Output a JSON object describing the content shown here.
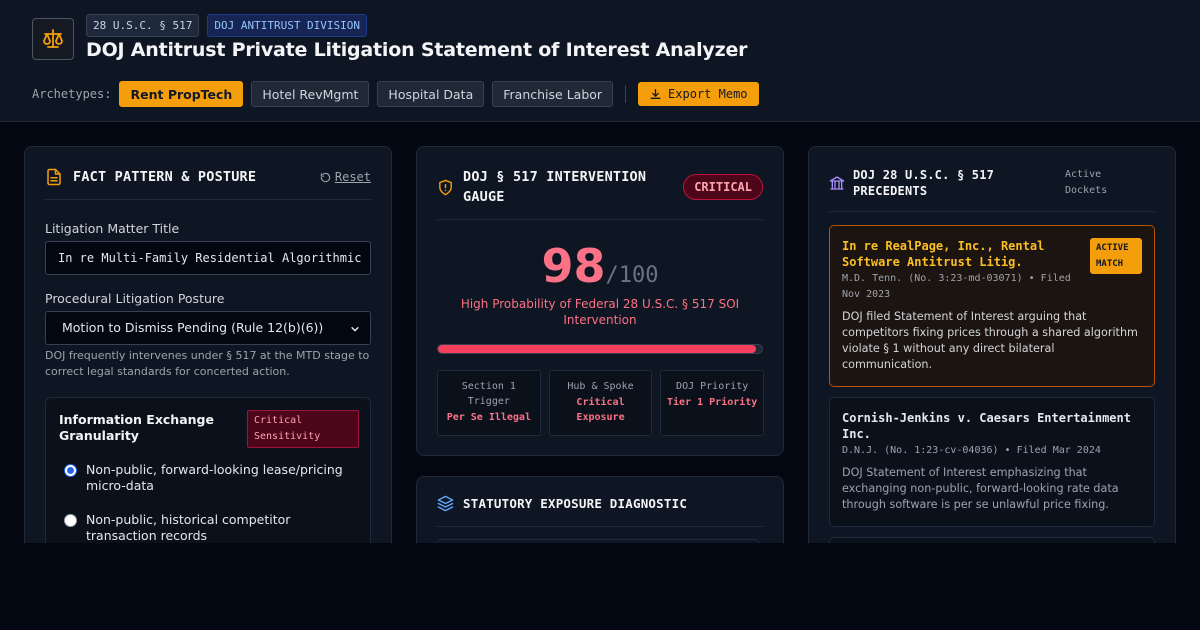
{
  "header": {
    "tag_statute": "28 U.S.C. § 517",
    "tag_division": "DOJ ANTITRUST DIVISION",
    "title": "DOJ Antitrust Private Litigation Statement of Interest Analyzer",
    "archetypes_label": "Archetypes:",
    "archetypes": [
      "Rent PropTech",
      "Hotel RevMgmt",
      "Hospital Data",
      "Franchise Labor"
    ],
    "active_archetype": "Rent PropTech",
    "export_label": "Export Memo",
    "logo_icon": "scales-icon"
  },
  "fact_pattern": {
    "title": "FACT PATTERN & POSTURE",
    "reset_label": "Reset",
    "matter_label": "Litigation Matter Title",
    "matter_value": "In re Multi-Family Residential Algorithmic",
    "posture_label": "Procedural Litigation Posture",
    "posture_value": "Motion to Dismiss Pending (Rule 12(b)(6))",
    "posture_help": "DOJ frequently intervenes under § 517 at the MTD stage to correct legal standards for concerted action.",
    "granularity": {
      "title": "Information Exchange Granularity",
      "badge": "Critical Sensitivity",
      "options": [
        {
          "label": "Non-public, forward-looking lease/pricing micro-data",
          "selected": true
        },
        {
          "label": "Non-public, historical competitor transaction records",
          "selected": false
        }
      ]
    }
  },
  "gauge": {
    "title": "DOJ § 517 INTERVENTION GAUGE",
    "severity": "CRITICAL",
    "score": "98",
    "score_max": "/100",
    "score_fraction": 0.98,
    "probability_text": "High Probability of Federal 28 U.S.C. § 517 SOI Intervention",
    "stats": [
      {
        "label": "Section 1 Trigger",
        "value": "Per Se Illegal"
      },
      {
        "label": "Hub & Spoke",
        "value": "Critical Exposure"
      },
      {
        "label": "DOJ Priority",
        "value": "Tier 1 Priority"
      }
    ]
  },
  "diagnostic": {
    "title": "STATUTORY EXPOSURE DIAGNOSTIC"
  },
  "precedents": {
    "title": "DOJ 28 U.S.C. § 517 PRECEDENTS",
    "status": "Active Dockets",
    "cases": [
      {
        "name": "In re RealPage, Inc., Rental Software Antitrust Litig.",
        "meta": "M.D. Tenn. (No. 3:23-md-03071) • Filed Nov 2023",
        "description": "DOJ filed Statement of Interest arguing that competitors fixing prices through a shared algorithm violate § 1 without any direct bilateral communication.",
        "badge": "ACTIVE MATCH"
      },
      {
        "name": "Cornish-Jenkins v. Caesars Entertainment Inc.",
        "meta": "D.N.J. (No. 1:23-cv-04036) • Filed Mar 2024",
        "description": "DOJ Statement of Interest emphasizing that exchanging non-public, forward-looking rate data through software is per se unlawful price fixing."
      }
    ]
  },
  "colors": {
    "accent": "#f59e0b",
    "critical": "#fb7185",
    "background": "#030712"
  }
}
